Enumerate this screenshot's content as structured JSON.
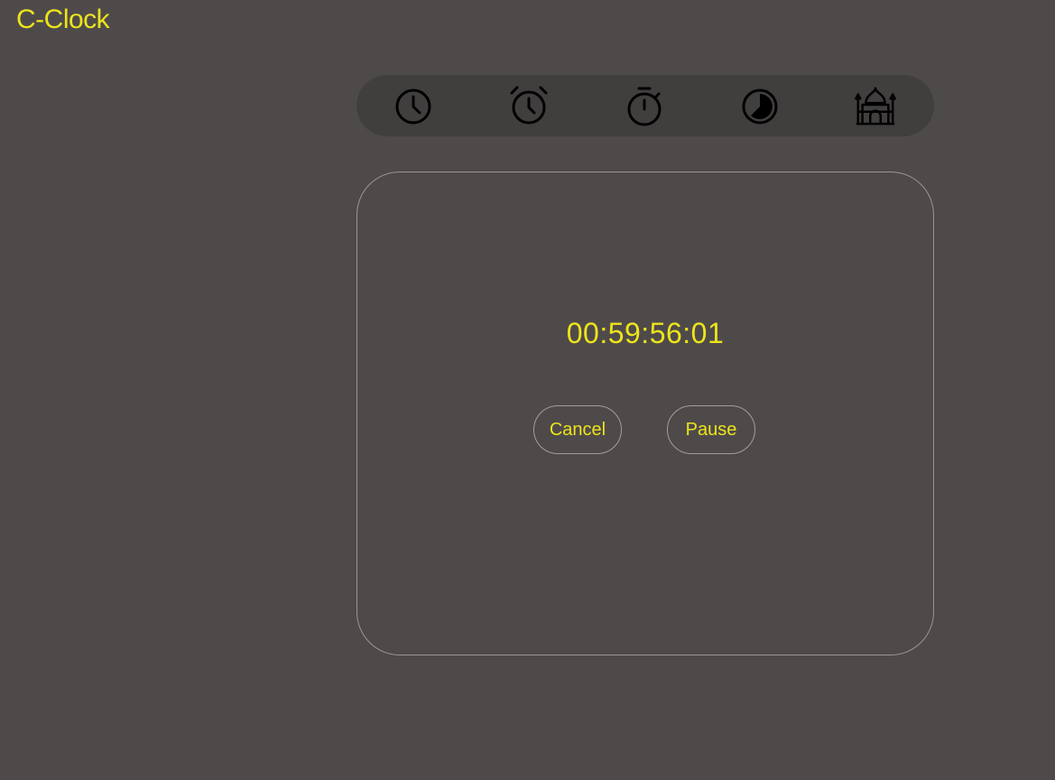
{
  "app": {
    "title": "C-Clock"
  },
  "nav": {
    "items": [
      {
        "icon": "clock-icon"
      },
      {
        "icon": "alarm-clock-icon"
      },
      {
        "icon": "stopwatch-icon"
      },
      {
        "icon": "timer-icon"
      },
      {
        "icon": "mosque-icon"
      }
    ]
  },
  "timer": {
    "display": "00:59:56:01",
    "cancel_label": "Cancel",
    "pause_label": "Pause"
  },
  "colors": {
    "background": "#4f4a4a",
    "nav_background": "#413e3e",
    "accent": "#ece41b",
    "border": "#9a9595"
  }
}
